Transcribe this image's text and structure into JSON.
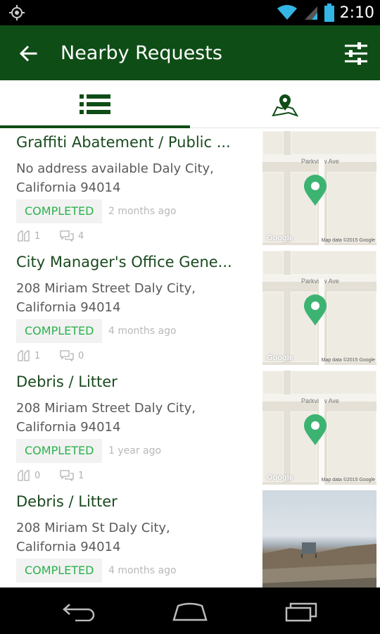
{
  "status_bar": {
    "time": "2:10"
  },
  "app_bar": {
    "title": "Nearby Requests"
  },
  "tabs": [
    {
      "name": "list",
      "icon": "list-icon",
      "active": true
    },
    {
      "name": "map",
      "icon": "map-pin-icon",
      "active": false
    }
  ],
  "requests": [
    {
      "title": "Graffiti Abatement / Public ...",
      "address_line1": "No address available Daly City,",
      "address_line2": "California 94014",
      "status": "COMPLETED",
      "time_ago": "2 months ago",
      "supporters": "1",
      "comments": "4",
      "thumbnail": "map",
      "map_street": "Parkview Ave",
      "map_google": "Google",
      "map_data": "Map data ©2015 Google"
    },
    {
      "title": "City Manager's Office Gene...",
      "address_line1": "208  Miriam Street Daly City,",
      "address_line2": "California 94014",
      "status": "COMPLETED",
      "time_ago": "4 months ago",
      "supporters": "1",
      "comments": "0",
      "thumbnail": "map",
      "map_street": "Parkview Ave",
      "map_google": "Google",
      "map_data": "Map data ©2015 Google"
    },
    {
      "title": "Debris / Litter",
      "address_line1": "208  Miriam Street Daly City,",
      "address_line2": "California 94014",
      "status": "COMPLETED",
      "time_ago": "1 year ago",
      "supporters": "0",
      "comments": "1",
      "thumbnail": "map",
      "map_street": "Parkview Ave",
      "map_google": "Google",
      "map_data": "Map data ©2015 Google"
    },
    {
      "title": "Debris / Litter",
      "address_line1": "208  Miriam St Daly City,",
      "address_line2": "California 94014",
      "status": "COMPLETED",
      "time_ago": "4 months ago",
      "thumbnail": "photo"
    }
  ],
  "colors": {
    "app_bar": "#0f4d16",
    "title_text": "#1a4a1f",
    "status_completed": "#2bb24c",
    "pin": "#3cb371"
  }
}
